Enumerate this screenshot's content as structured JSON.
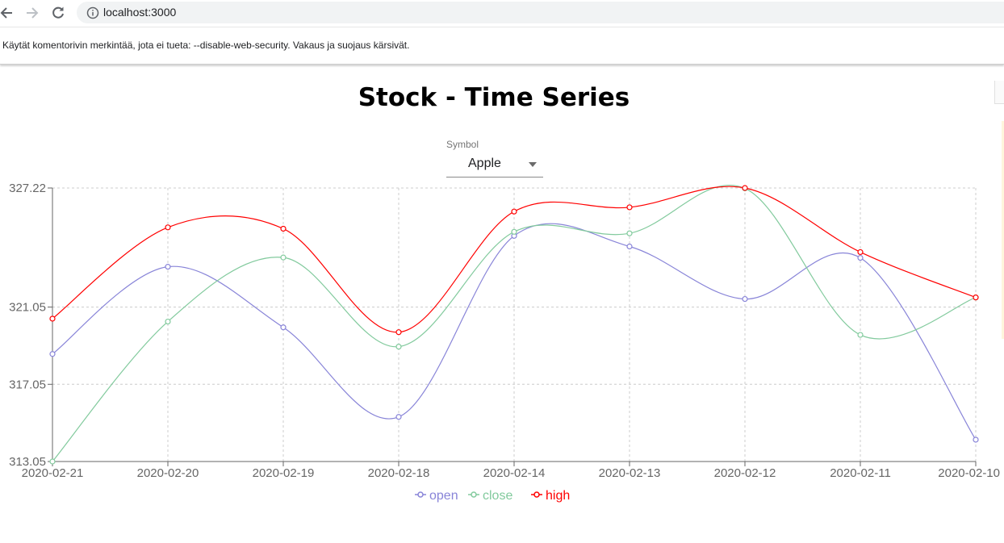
{
  "browser": {
    "url": "localhost:3000",
    "infobar_message": "Käytät komentorivin merkintää, jota ei tueta: --disable-web-security. Vakaus ja suojaus kärsivät."
  },
  "page": {
    "title": "Stock - Time Series",
    "symbol_label": "Symbol",
    "symbol_value": "Apple"
  },
  "chart_data": {
    "type": "line",
    "x": [
      "2020-02-21",
      "2020-02-20",
      "2020-02-19",
      "2020-02-18",
      "2020-02-14",
      "2020-02-13",
      "2020-02-12",
      "2020-02-11",
      "2020-02-10"
    ],
    "ylim": [
      313.05,
      327.22
    ],
    "yticks": [
      "313.05",
      "317.05",
      "321.05",
      "327.22"
    ],
    "grid": true,
    "legend_position": "bottom",
    "series": [
      {
        "name": "open",
        "color": "#8884d8",
        "values": [
          318.62,
          323.14,
          320.0,
          315.36,
          324.74,
          324.19,
          321.47,
          323.6,
          314.18
        ]
      },
      {
        "name": "close",
        "color": "#82ca9d",
        "values": [
          313.05,
          320.3,
          323.62,
          319.0,
          324.95,
          324.87,
          327.2,
          319.61,
          321.55
        ]
      },
      {
        "name": "high",
        "color": "#ff0000",
        "values": [
          320.45,
          325.18,
          325.11,
          319.75,
          326.0,
          326.22,
          327.22,
          323.9,
          321.55
        ]
      }
    ]
  }
}
